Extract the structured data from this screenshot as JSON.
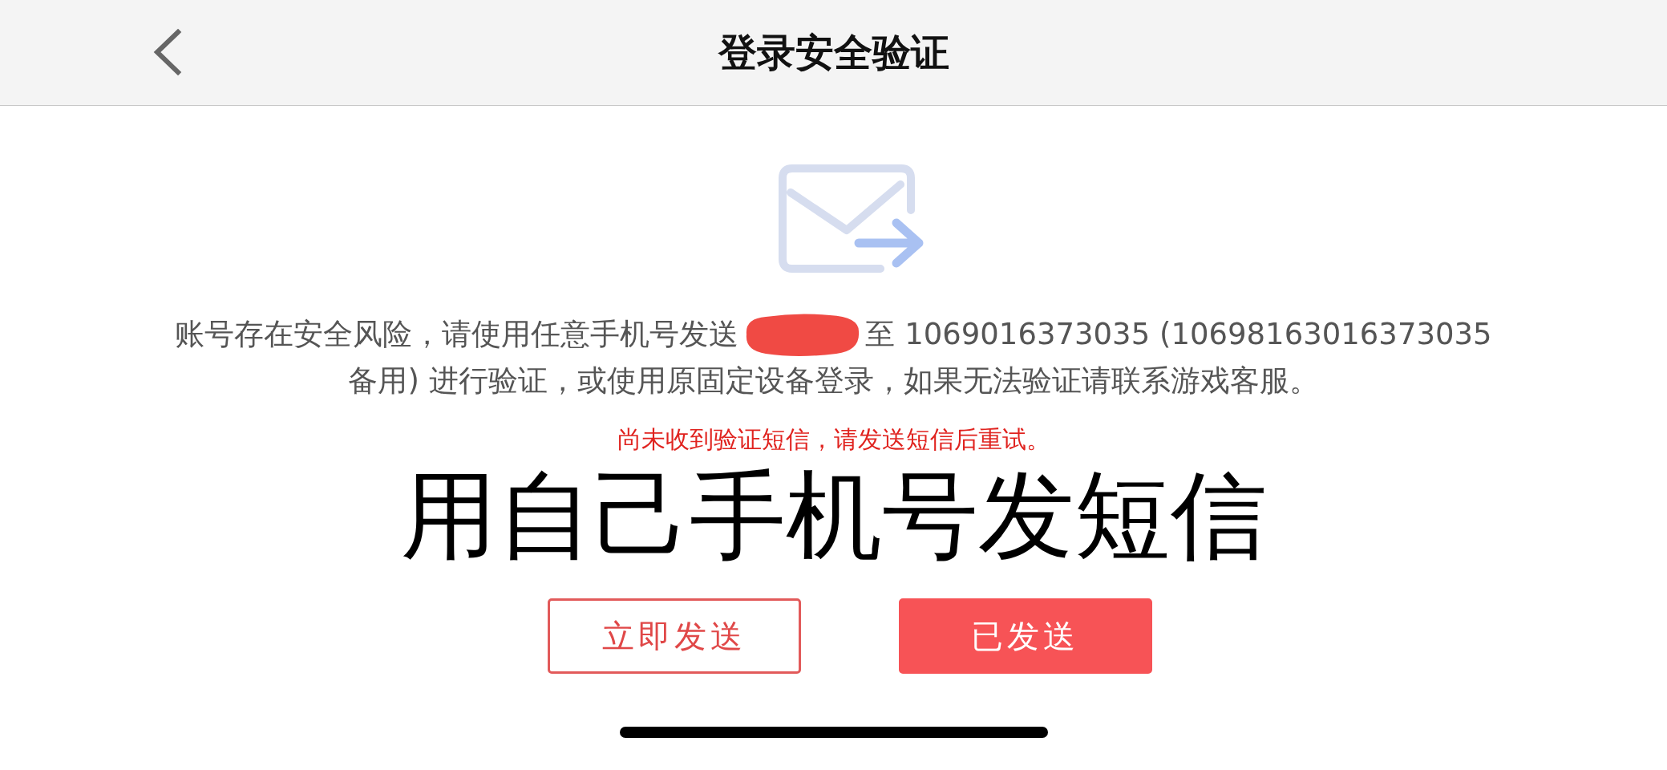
{
  "header": {
    "title": "登录安全验证"
  },
  "notice": {
    "text_before": "账号存在安全风险，请使用任意手机号发送",
    "redacted": true,
    "text_after": "至 1069016373035 (10698163016373035",
    "text_continued": "备用) 进行验证，或使用原固定设备登录，如果无法验证请联系游戏客服。"
  },
  "error_message": "尚未收到验证短信，请发送短信后重试。",
  "annotation": "用自己手机号发短信",
  "buttons": [
    {
      "label": "立即发送",
      "kind": "outline"
    },
    {
      "label": "已发送",
      "kind": "filled"
    }
  ]
}
